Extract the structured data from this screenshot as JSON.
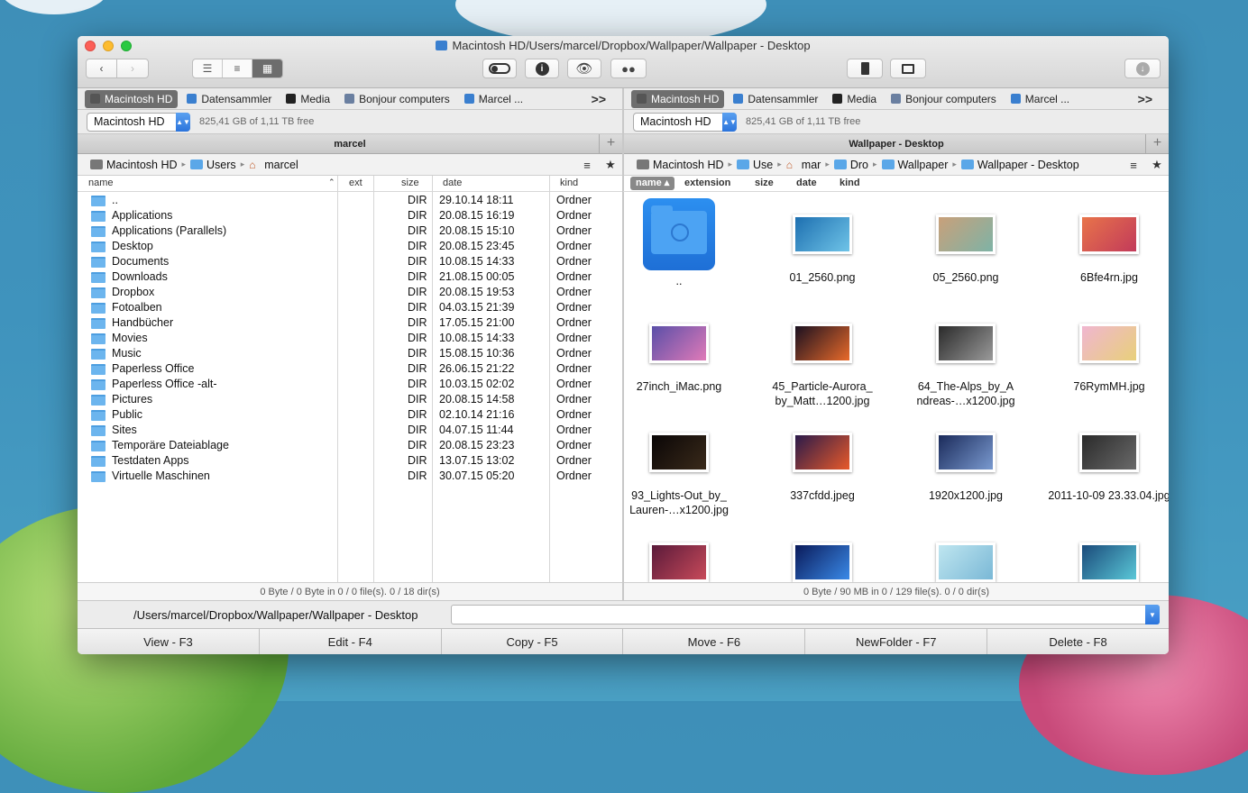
{
  "window": {
    "title": "Macintosh HD/Users/marcel/Dropbox/Wallpaper/Wallpaper - Desktop"
  },
  "toolbar": {
    "back_icon": "chevron-left",
    "forward_icon": "chevron-right",
    "view_modes": [
      "list-view",
      "detail-view",
      "icon-view"
    ],
    "active_view_mode": "icon-view",
    "center_buttons": [
      "toggle-hidden",
      "info",
      "quick-look",
      "find"
    ],
    "right_buttons": [
      "archive",
      "network-share"
    ],
    "download_icon": "download"
  },
  "favorites": {
    "items": [
      "Macintosh HD",
      "Datensammler",
      "Media",
      "Bonjour computers",
      "Marcel ..."
    ],
    "active": "Macintosh HD",
    "more": ">>"
  },
  "left": {
    "drive": "Macintosh HD",
    "free": "825,41 GB of 1,11 TB free",
    "header": "marcel",
    "breadcrumb": [
      "Macintosh HD",
      "Users",
      "marcel"
    ],
    "columns": {
      "name": "name",
      "ext": "ext",
      "size": "size",
      "date": "date",
      "kind": "kind"
    },
    "rows": [
      {
        "name": "..",
        "size": "DIR",
        "date": "29.10.14 18:11",
        "kind": "Ordner"
      },
      {
        "name": "Applications",
        "size": "DIR",
        "date": "20.08.15 16:19",
        "kind": "Ordner"
      },
      {
        "name": "Applications (Parallels)",
        "size": "DIR",
        "date": "20.08.15 15:10",
        "kind": "Ordner"
      },
      {
        "name": "Desktop",
        "size": "DIR",
        "date": "20.08.15 23:45",
        "kind": "Ordner"
      },
      {
        "name": "Documents",
        "size": "DIR",
        "date": "10.08.15 14:33",
        "kind": "Ordner"
      },
      {
        "name": "Downloads",
        "size": "DIR",
        "date": "21.08.15 00:05",
        "kind": "Ordner"
      },
      {
        "name": "Dropbox",
        "size": "DIR",
        "date": "20.08.15 19:53",
        "kind": "Ordner"
      },
      {
        "name": "Fotoalben",
        "size": "DIR",
        "date": "04.03.15 21:39",
        "kind": "Ordner"
      },
      {
        "name": "Handbücher",
        "size": "DIR",
        "date": "17.05.15 21:00",
        "kind": "Ordner"
      },
      {
        "name": "Movies",
        "size": "DIR",
        "date": "10.08.15 14:33",
        "kind": "Ordner"
      },
      {
        "name": "Music",
        "size": "DIR",
        "date": "15.08.15 10:36",
        "kind": "Ordner"
      },
      {
        "name": "Paperless Office",
        "size": "DIR",
        "date": "26.06.15 21:22",
        "kind": "Ordner"
      },
      {
        "name": "Paperless Office -alt-",
        "size": "DIR",
        "date": "10.03.15 02:02",
        "kind": "Ordner"
      },
      {
        "name": "Pictures",
        "size": "DIR",
        "date": "20.08.15 14:58",
        "kind": "Ordner"
      },
      {
        "name": "Public",
        "size": "DIR",
        "date": "02.10.14 21:16",
        "kind": "Ordner"
      },
      {
        "name": "Sites",
        "size": "DIR",
        "date": "04.07.15 11:44",
        "kind": "Ordner"
      },
      {
        "name": "Temporäre Dateiablage",
        "size": "DIR",
        "date": "20.08.15 23:23",
        "kind": "Ordner"
      },
      {
        "name": "Testdaten Apps",
        "size": "DIR",
        "date": "13.07.15 13:02",
        "kind": "Ordner"
      },
      {
        "name": "Virtuelle Maschinen",
        "size": "DIR",
        "date": "30.07.15 05:20",
        "kind": "Ordner"
      }
    ],
    "status": "0 Byte / 0 Byte in 0 / 0 file(s). 0 / 18 dir(s)"
  },
  "right": {
    "drive": "Macintosh HD",
    "free": "825,41 GB of 1,11 TB free",
    "header": "Wallpaper - Desktop",
    "breadcrumb": [
      "Macintosh HD",
      "Use",
      "mar",
      "Dro",
      "Wallpaper",
      "Wallpaper - Desktop"
    ],
    "sort_columns": [
      "name",
      "extension",
      "size",
      "date",
      "kind"
    ],
    "active_sort": "name",
    "tiles": [
      {
        "label": "..",
        "colors": [
          "#2c8ff0",
          "#1e6fd6"
        ]
      },
      {
        "label": "01_2560.png",
        "colors": [
          "#1d6fb0",
          "#6fc4e8"
        ]
      },
      {
        "label": "05_2560.png",
        "colors": [
          "#c9a07a",
          "#7eb3a6"
        ]
      },
      {
        "label": "6Bfe4rn.jpg",
        "colors": [
          "#e8744a",
          "#c23a5a"
        ]
      },
      {
        "label": "27inch_iMac.png",
        "colors": [
          "#5a4fa8",
          "#e07ab8"
        ]
      },
      {
        "label": "45_Particle-Aurora_ by_Matt…1200.jpg",
        "colors": [
          "#1a1020",
          "#e86a2a"
        ]
      },
      {
        "label": "64_The-Alps_by_A ndreas-…x1200.jpg",
        "colors": [
          "#2a2a2a",
          "#9a9a9a"
        ]
      },
      {
        "label": "76RymMH.jpg",
        "colors": [
          "#f0b6d0",
          "#e8d07a"
        ]
      },
      {
        "label": "93_Lights-Out_by_ Lauren-…x1200.jpg",
        "colors": [
          "#0a0606",
          "#3a2a1a"
        ]
      },
      {
        "label": "337cfdd.jpeg",
        "colors": [
          "#2a1a4a",
          "#e85a2a"
        ]
      },
      {
        "label": "1920x1200.jpg",
        "colors": [
          "#1a2a5a",
          "#7a9ad0"
        ]
      },
      {
        "label": "2011-10-09 23.33.04.jpg",
        "colors": [
          "#2a2a2a",
          "#6a6a6a"
        ]
      },
      {
        "label": "",
        "colors": [
          "#5a1a3a",
          "#c84a5a"
        ]
      },
      {
        "label": "",
        "colors": [
          "#0a1a5a",
          "#3a8ae8"
        ]
      },
      {
        "label": "",
        "colors": [
          "#bfe6f0",
          "#7ab8d6"
        ]
      },
      {
        "label": "",
        "colors": [
          "#1a4a7a",
          "#5ac8d8"
        ]
      }
    ],
    "status": "0 Byte / 90 MB in 0 / 129 file(s). 0 / 0 dir(s)"
  },
  "cmdline": {
    "path": "/Users/marcel/Dropbox/Wallpaper/Wallpaper - Desktop",
    "value": ""
  },
  "fkeys": [
    "View - F3",
    "Edit - F4",
    "Copy - F5",
    "Move - F6",
    "NewFolder - F7",
    "Delete - F8"
  ]
}
